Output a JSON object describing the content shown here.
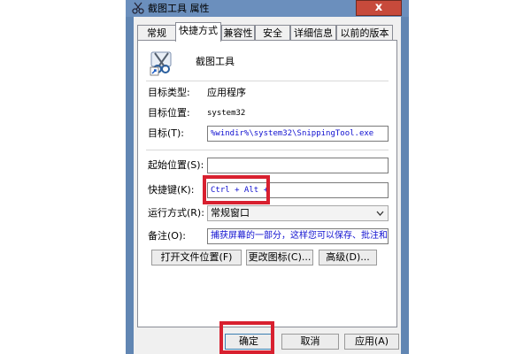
{
  "window": {
    "title": "截图工具 属性",
    "close_label": "x"
  },
  "tabs": [
    {
      "label": "常规"
    },
    {
      "label": "快捷方式",
      "active": true
    },
    {
      "label": "兼容性"
    },
    {
      "label": "安全"
    },
    {
      "label": "详细信息"
    },
    {
      "label": "以前的版本"
    }
  ],
  "header": {
    "app_name": "截图工具",
    "icon": "snipping-tool-shortcut-icon"
  },
  "properties": {
    "target_type_label": "目标类型:",
    "target_type_value": "应用程序",
    "target_location_label": "目标位置:",
    "target_location_value": "system32",
    "target_label": "目标(T):",
    "target_value": "%windir%\\system32\\SnippingTool.exe",
    "start_in_label": "起始位置(S):",
    "start_in_value": "",
    "shortcut_key_label": "快捷键(K):",
    "shortcut_key_value": "Ctrl + Alt +",
    "run_label": "运行方式(R):",
    "run_value": "常规窗口",
    "comment_label": "备注(O):",
    "comment_value": "捕获屏幕的一部分，这样您可以保存、批注和共享该图像。"
  },
  "actions": {
    "open_location": "打开文件位置(F)",
    "change_icon": "更改图标(C)...",
    "advanced": "高级(D)..."
  },
  "footer": {
    "ok": "确定",
    "cancel": "取消",
    "apply": "应用(A)"
  },
  "colors": {
    "highlight": "#d8202f",
    "titlebar": "#6b8fbd",
    "close": "#c74a3b"
  }
}
